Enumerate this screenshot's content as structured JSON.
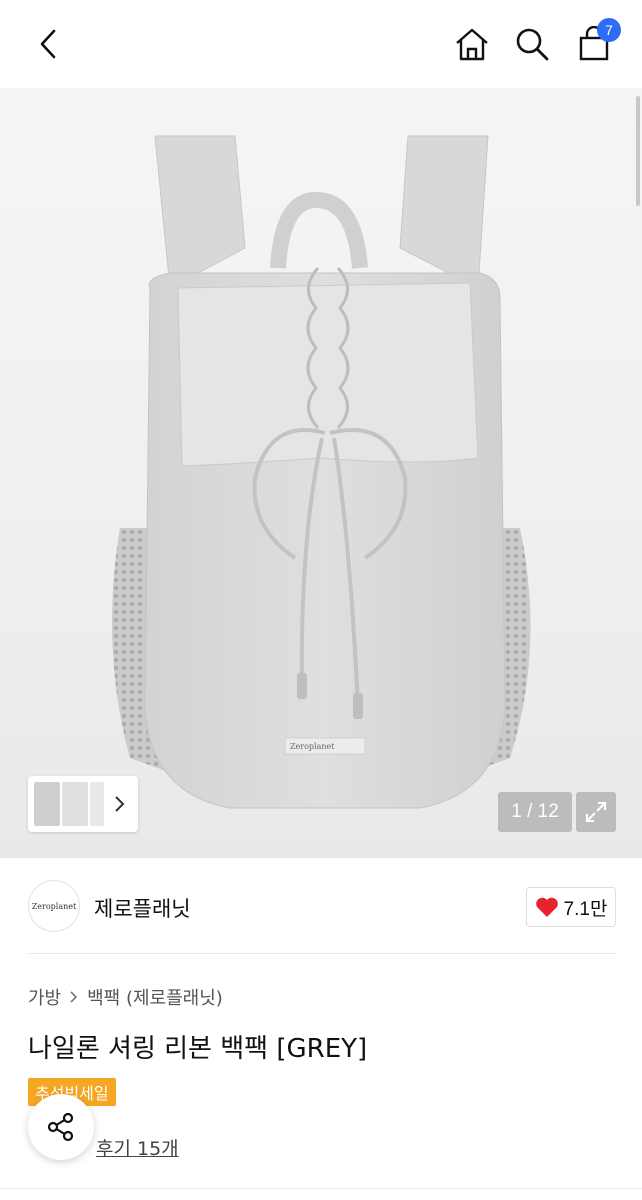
{
  "header": {
    "back_icon": "chevron-left-icon",
    "home_icon": "home-icon",
    "search_icon": "search-icon",
    "cart_icon": "shopping-bag-icon",
    "cart_badge": "7",
    "badge_color": "#2d6df6"
  },
  "gallery": {
    "counter": "1 / 12",
    "expand_icon": "expand-icon",
    "thumbs_arrow_icon": "chevron-right-icon",
    "product_label": "Zeroplanet"
  },
  "brand": {
    "logo_text": "Zeroplanet",
    "name": "제로플래닛",
    "likes": "7.1만",
    "heart_color": "#e5242c"
  },
  "product": {
    "breadcrumb": [
      "가방",
      "백팩 (제로플래닛)"
    ],
    "title": "나일론 셔링 리본 백팩 [GREY]",
    "tag": "추석빅세일",
    "tag_color": "#f5a623",
    "review_link": "후기 15개"
  },
  "share": {
    "icon": "share-icon"
  }
}
